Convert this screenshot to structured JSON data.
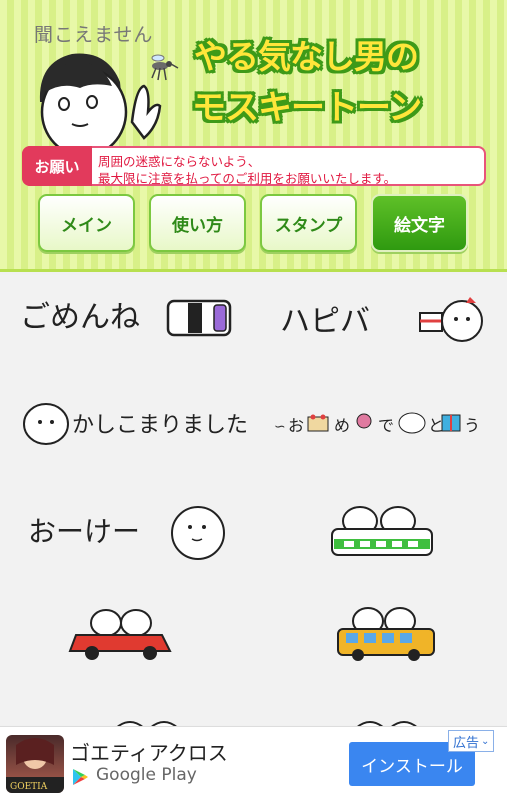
{
  "header": {
    "subtitle": "聞こえません",
    "title_line1": "やる気なし男の",
    "title_line2": "モスキートーン"
  },
  "notice": {
    "badge": "お願い",
    "line1": "周囲の迷惑にならないよう、",
    "line2": "最大限に注意を払ってのご利用をお願いいたします。"
  },
  "nav": [
    {
      "label": "メイン"
    },
    {
      "label": "使い方"
    },
    {
      "label": "スタンプ"
    },
    {
      "label": "絵文字",
      "active": true
    }
  ],
  "stickers": {
    "gomenne": "ごめんね",
    "happy": "ハピバ",
    "kashikomari": "かしこまりました。",
    "omedetou_chars": [
      "お",
      "め",
      "で",
      "と",
      "う"
    ],
    "okay": "おーけー"
  },
  "ad": {
    "title": "ゴエティアクロス",
    "store": "Google Play",
    "install": "インストール",
    "label": "広告",
    "icon_text": "GOETIA"
  }
}
